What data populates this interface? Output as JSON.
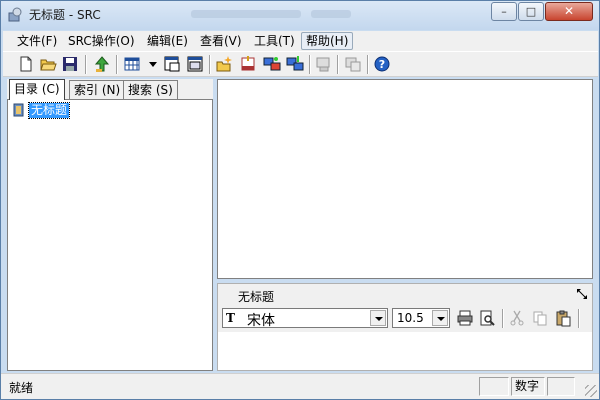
{
  "window": {
    "title": "无标题 - SRC",
    "buttons": {
      "minimize": "–",
      "maximize": "□",
      "close": "✕"
    }
  },
  "menu": {
    "items": [
      "文件(F)",
      "SRC操作(O)",
      "编辑(E)",
      "查看(V)",
      "工具(T)",
      "帮助(H)"
    ]
  },
  "toolbar": {
    "icons": [
      "new-document-icon",
      "open-folder-icon",
      "save-icon",
      "up-arrow-icon",
      "view-grid-icon",
      "dropdown-arrow-icon",
      "window-a-icon",
      "window-b-icon",
      "new-project-icon",
      "src-compile-icon",
      "network-a-icon",
      "network-b-icon",
      "disabled-a-icon",
      "disabled-b-icon",
      "help-icon"
    ]
  },
  "leftpane": {
    "tabs": [
      "目录 (C)",
      "索引 (N)",
      "搜索 (S)"
    ],
    "tree_item": "无标题"
  },
  "bottompane": {
    "title": "无标题",
    "font_name": "宋体",
    "font_size": "10.5",
    "font_icon": "T"
  },
  "status": {
    "text": "就绪",
    "num_label": "数字"
  },
  "colors": {
    "selection": "#3399ff",
    "chrome": "#c9dcf0",
    "close_red": "#c8442f"
  }
}
